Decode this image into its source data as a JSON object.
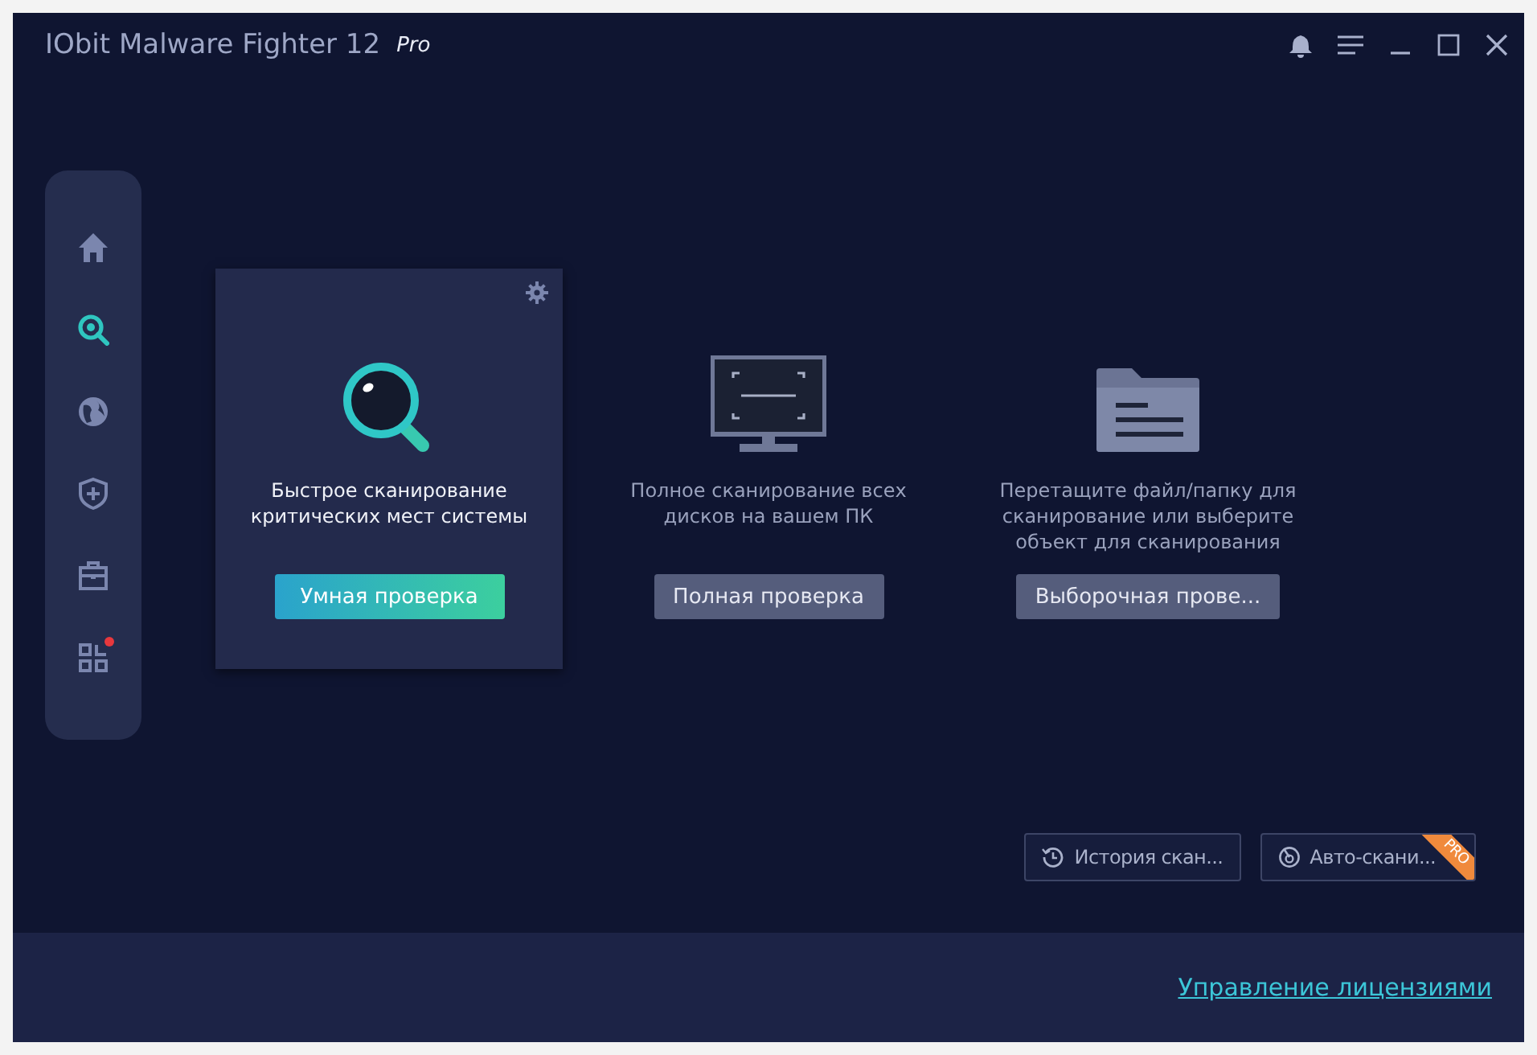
{
  "window": {
    "title": "IObit Malware Fighter 12",
    "edition": "Pro"
  },
  "sidebar": {
    "items": [
      {
        "selected": false,
        "alert": false
      },
      {
        "selected": true,
        "alert": false
      },
      {
        "selected": false,
        "alert": false
      },
      {
        "selected": false,
        "alert": false
      },
      {
        "selected": false,
        "alert": false
      },
      {
        "selected": false,
        "alert": true
      }
    ]
  },
  "scan_cards": [
    {
      "selected": true,
      "description": "Быстрое сканирование критических мест системы",
      "button": "Умная проверка"
    },
    {
      "selected": false,
      "description": "Полное сканирование всех дисков на вашем ПК",
      "button": "Полная проверка"
    },
    {
      "selected": false,
      "description": "Перетащите файл/папку для сканирование или выберите объект для сканирования",
      "button": "Выборочная прове..."
    }
  ],
  "bottom_buttons": [
    {
      "label": "История скан...",
      "pro": false
    },
    {
      "label": "Авто-скани...",
      "pro": true,
      "ribbon": "PRO"
    }
  ],
  "footer": {
    "link": "Управление лицензиями"
  }
}
